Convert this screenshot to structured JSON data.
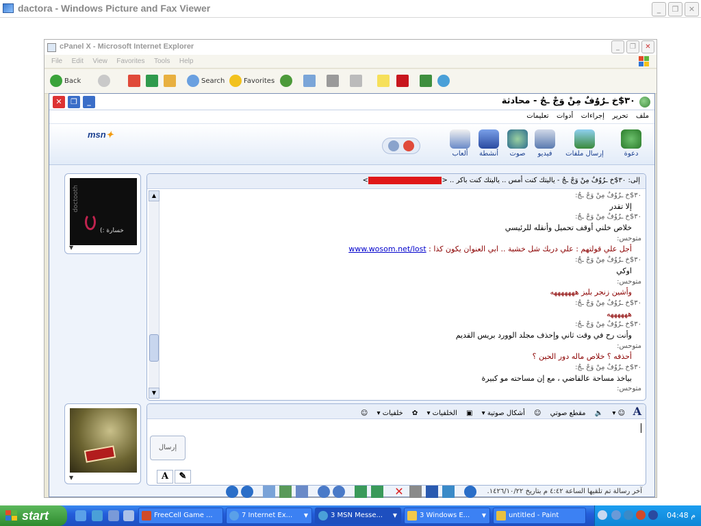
{
  "viewer": {
    "title": "dactora - Windows Picture and Fax Viewer",
    "minimize": "_",
    "maximize": "❐",
    "close": "✕"
  },
  "ie": {
    "title": "cPanel X - Microsoft Internet Explorer",
    "menu": [
      "File",
      "Edit",
      "View",
      "Favorites",
      "Tools",
      "Help"
    ],
    "toolbar": {
      "back": "Back",
      "search": "Search",
      "favorites": "Favorites"
    }
  },
  "msn": {
    "title": "٣٠$خ ـرٌوٌفٌ مِنْ وَجْ ـجُ - محادثة",
    "menu": [
      "ملف",
      "تحرير",
      "إجراءات",
      "أدوات",
      "تعليمات"
    ],
    "logo": "msn",
    "actions": [
      "دعوة",
      "إرسال ملفات",
      "فيديو",
      "صوت",
      "أنشطة",
      "ألعاب"
    ],
    "to_line": "إلى: ٣٠$خ ـرٌوٌفٌ مِنْ وَجْ ـجُ - ياليتك كنت أمس .. ياليتك كنت باكر .. <",
    "to_email": "xxxxxxxxxxxxxx.com",
    "to_close": ">",
    "avatar_brand": "doctooth",
    "avatar_caption": "خسارة :)",
    "messages": [
      {
        "type": "sender",
        "text": "٣٠$خ ـرٌوٌفٌ مِنْ وَجْ ـجُ:"
      },
      {
        "type": "body",
        "color": "black",
        "text": "إلا تقدر"
      },
      {
        "type": "sender",
        "text": "٣٠$خ ـرٌوٌفٌ مِنْ وَجْ ـجُ:"
      },
      {
        "type": "body",
        "color": "black",
        "text": "خلاص خلني أوقف تحميل وأنقله للرئيسي"
      },
      {
        "type": "sender",
        "text": "متوحس:"
      },
      {
        "type": "body",
        "color": "red",
        "text": "أجل علي قولتهم : علي دربك شل خشبة .. ابي العنوان يكون كذا : ",
        "link": "www.wosom.net/lost"
      },
      {
        "type": "sender",
        "text": "٣٠$خ ـرٌوٌفٌ مِنْ وَجْ ـجُ:"
      },
      {
        "type": "body",
        "color": "black",
        "text": "اوكي"
      },
      {
        "type": "sender",
        "text": "متوحس:"
      },
      {
        "type": "body",
        "color": "red",
        "text": "وأشين زنجر بليز هههههههه"
      },
      {
        "type": "sender",
        "text": "٣٠$خ ـرٌوٌفٌ مِنْ وَجْ ـجُ:"
      },
      {
        "type": "body",
        "color": "red",
        "text": "ههههههه"
      },
      {
        "type": "sender",
        "text": "٣٠$خ ـرٌوٌفٌ مِنْ وَجْ ـجُ:"
      },
      {
        "type": "body",
        "color": "black",
        "text": "وأنت رح في وقت ثاني وإحذف مجلد الوورد بريس القديم"
      },
      {
        "type": "sender",
        "text": "متوحس:"
      },
      {
        "type": "body",
        "color": "red",
        "text": "أحذفه ؟ خلاص ماله دور الحين ؟"
      },
      {
        "type": "sender",
        "text": "٣٠$خ ـرٌوٌفٌ مِنْ وَجْ ـجُ:"
      },
      {
        "type": "body",
        "color": "black",
        "text": "بياخذ مساحة عالفاضي ، مع إن مساحته مو كبيرة"
      },
      {
        "type": "sender",
        "text": "متوحس:"
      }
    ],
    "input_toolbar": [
      "مقطع صوتي",
      "أشكال صوتية",
      "الخلفيات",
      "خلفيات"
    ],
    "font_glyph": "A",
    "send": "إرسال",
    "status": "آخر رسالة تم تلقيها الساعة ٤:٤٢ م بتاريخ ١٤٢٦/١٠/٢٢."
  },
  "taskbar": {
    "start": "start",
    "tasks": [
      "FreeCell Game ...",
      "7 Internet Ex...",
      "3 MSN Messe...",
      "3 Windows E...",
      "untitled - Paint"
    ],
    "clock": "04:48 م"
  }
}
